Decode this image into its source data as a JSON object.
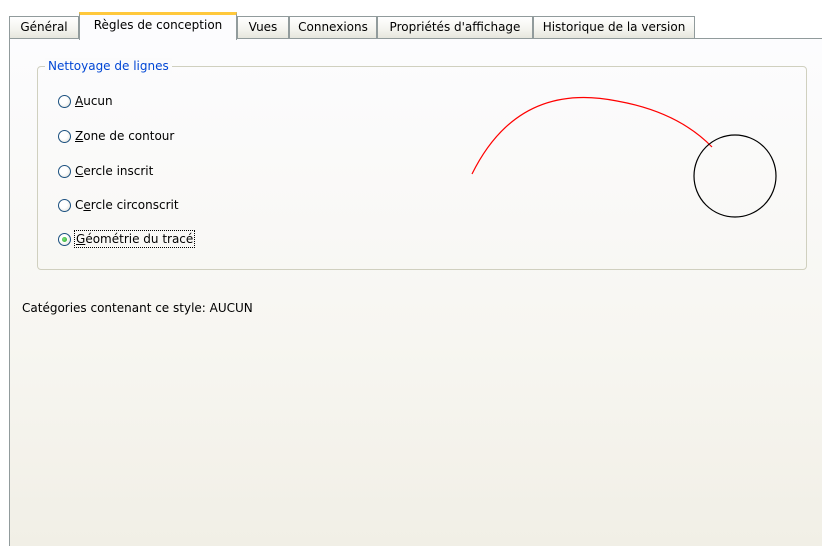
{
  "tabs": [
    {
      "label": "Général"
    },
    {
      "label": "Règles de conception"
    },
    {
      "label": "Vues"
    },
    {
      "label": "Connexions"
    },
    {
      "label": "Propriétés d'affichage"
    },
    {
      "label": "Historique de la version"
    }
  ],
  "active_tab": "Règles de conception",
  "cleanup": {
    "legend": "Nettoyage de lignes",
    "options": [
      {
        "label": "Aucun",
        "mnemonic": "A",
        "checked": false
      },
      {
        "label": "Zone de contour",
        "mnemonic": "Z",
        "checked": false
      },
      {
        "label": "Cercle inscrit",
        "mnemonic": "C",
        "checked": false
      },
      {
        "label": "Cercle circonscrit",
        "mnemonic": "e",
        "checked": false
      },
      {
        "label": "Géométrie du tracé",
        "mnemonic": "G",
        "checked": true
      }
    ]
  },
  "categories_text": "Catégories contenant ce style: AUCUN",
  "colors": {
    "arc": "#ff0000",
    "circle": "#000000",
    "legend": "#0046d5",
    "tab_highlight": "#ffc83c"
  }
}
